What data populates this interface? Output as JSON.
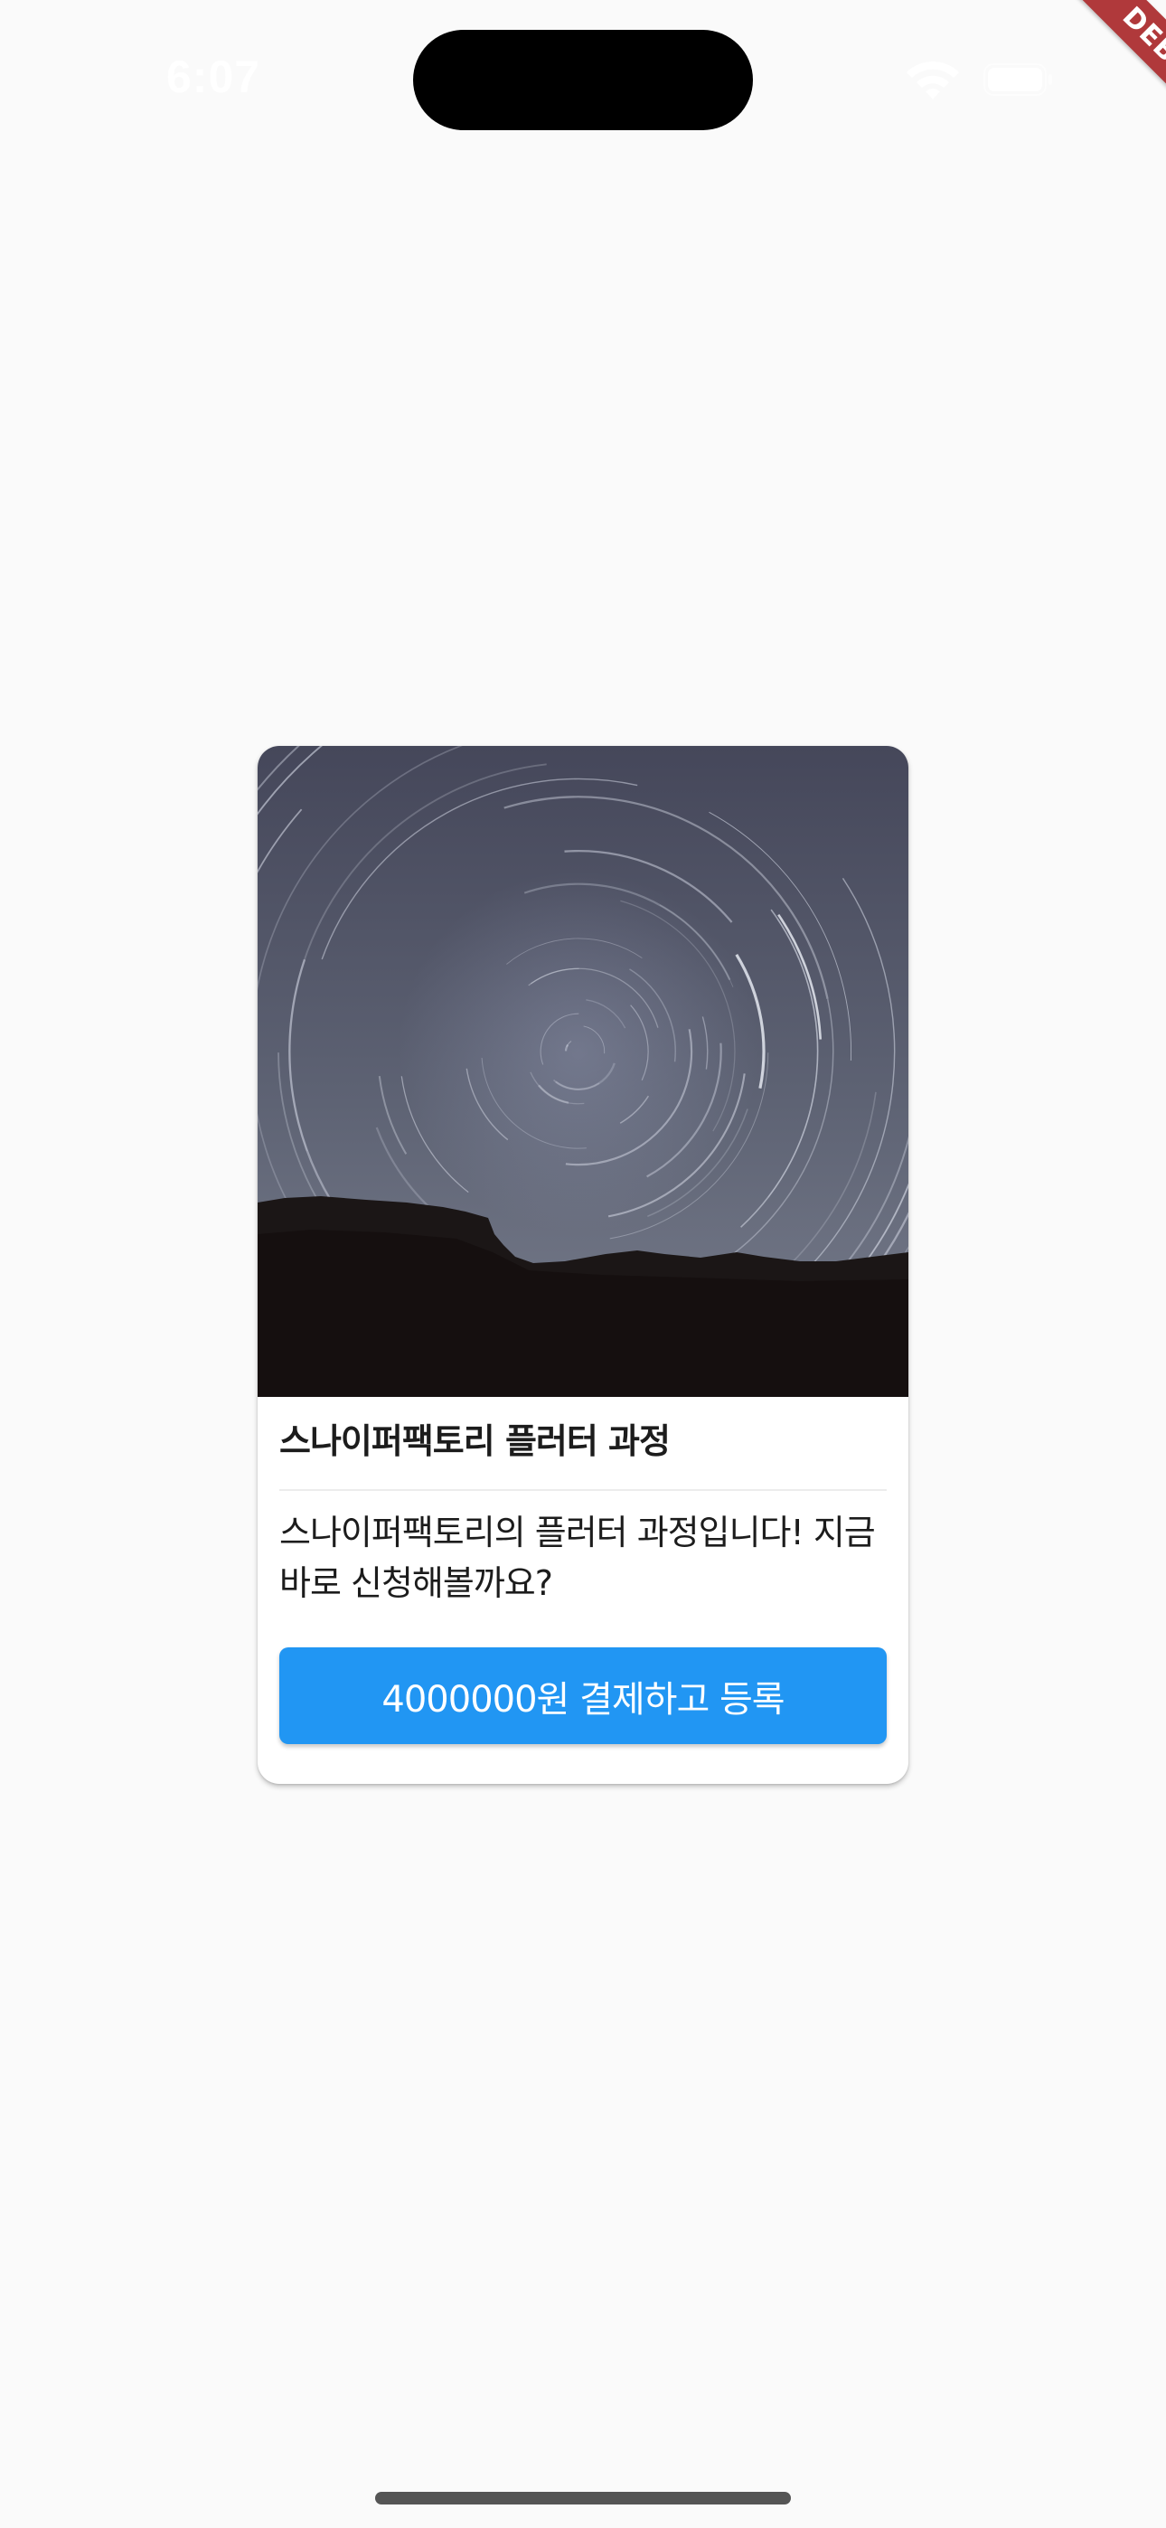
{
  "status_bar": {
    "time": "6:07",
    "icons": [
      "wifi-icon",
      "battery-icon"
    ]
  },
  "debug_banner": {
    "label": "DEBUG",
    "color": "#b0393b"
  },
  "card": {
    "image_icon": "star-trails-photo",
    "title": "스나이퍼팩토리 플러터 과정",
    "description": "스나이퍼팩토리의 플러터 과정입니다! 지금 바로 신청해볼까요?",
    "button_label": "4000000원 결제하고 등록"
  },
  "colors": {
    "background": "#fafafa",
    "accent": "#2196f3",
    "card": "#ffffff"
  }
}
